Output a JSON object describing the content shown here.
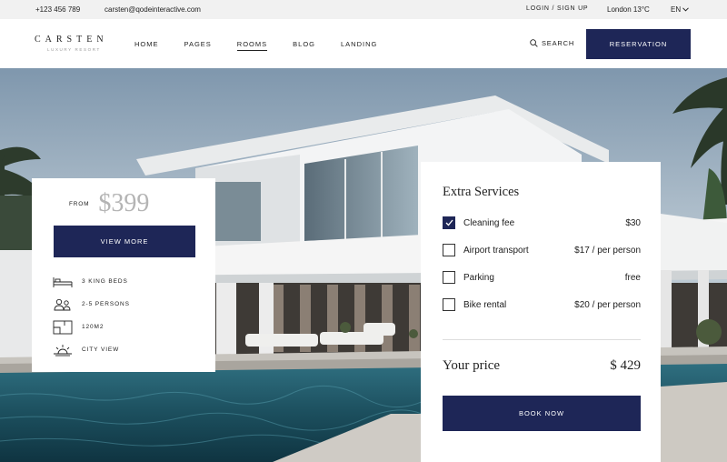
{
  "topbar": {
    "phone": "+123 456 789",
    "email": "carsten@qodeinteractive.com",
    "login": "LOGIN / SIGN UP",
    "weather": "London 13°C",
    "language": "EN"
  },
  "header": {
    "brand": "CARSTEN",
    "tagline": "LUXURY RESORT",
    "nav": [
      "HOME",
      "PAGES",
      "ROOMS",
      "BLOG",
      "LANDING"
    ],
    "active_nav": "ROOMS",
    "search_label": "SEARCH",
    "reservation_label": "RESERVATION"
  },
  "room_card": {
    "from_label": "FROM",
    "price": "$399",
    "view_more_label": "VIEW MORE",
    "features": [
      {
        "icon": "bed-icon",
        "label": "3 KING BEDS"
      },
      {
        "icon": "persons-icon",
        "label": "2-5 PERSONS"
      },
      {
        "icon": "floorplan-icon",
        "label": "120M2"
      },
      {
        "icon": "sunrise-icon",
        "label": "CITY VIEW"
      }
    ]
  },
  "extra_services": {
    "title": "Extra Services",
    "services": [
      {
        "name": "Cleaning fee",
        "cost": "$30",
        "checked": true
      },
      {
        "name": "Airport transport",
        "cost": "$17 / per person",
        "checked": false
      },
      {
        "name": "Parking",
        "cost": "free",
        "checked": false
      },
      {
        "name": "Bike rental",
        "cost": "$20 / per person",
        "checked": false
      }
    ],
    "your_price_label": "Your price",
    "total": "$ 429",
    "book_now_label": "BOOK NOW"
  },
  "colors": {
    "accent": "#1e2657",
    "topbar_bg": "#f1f1f1",
    "price_grey": "#b4b4b4"
  }
}
